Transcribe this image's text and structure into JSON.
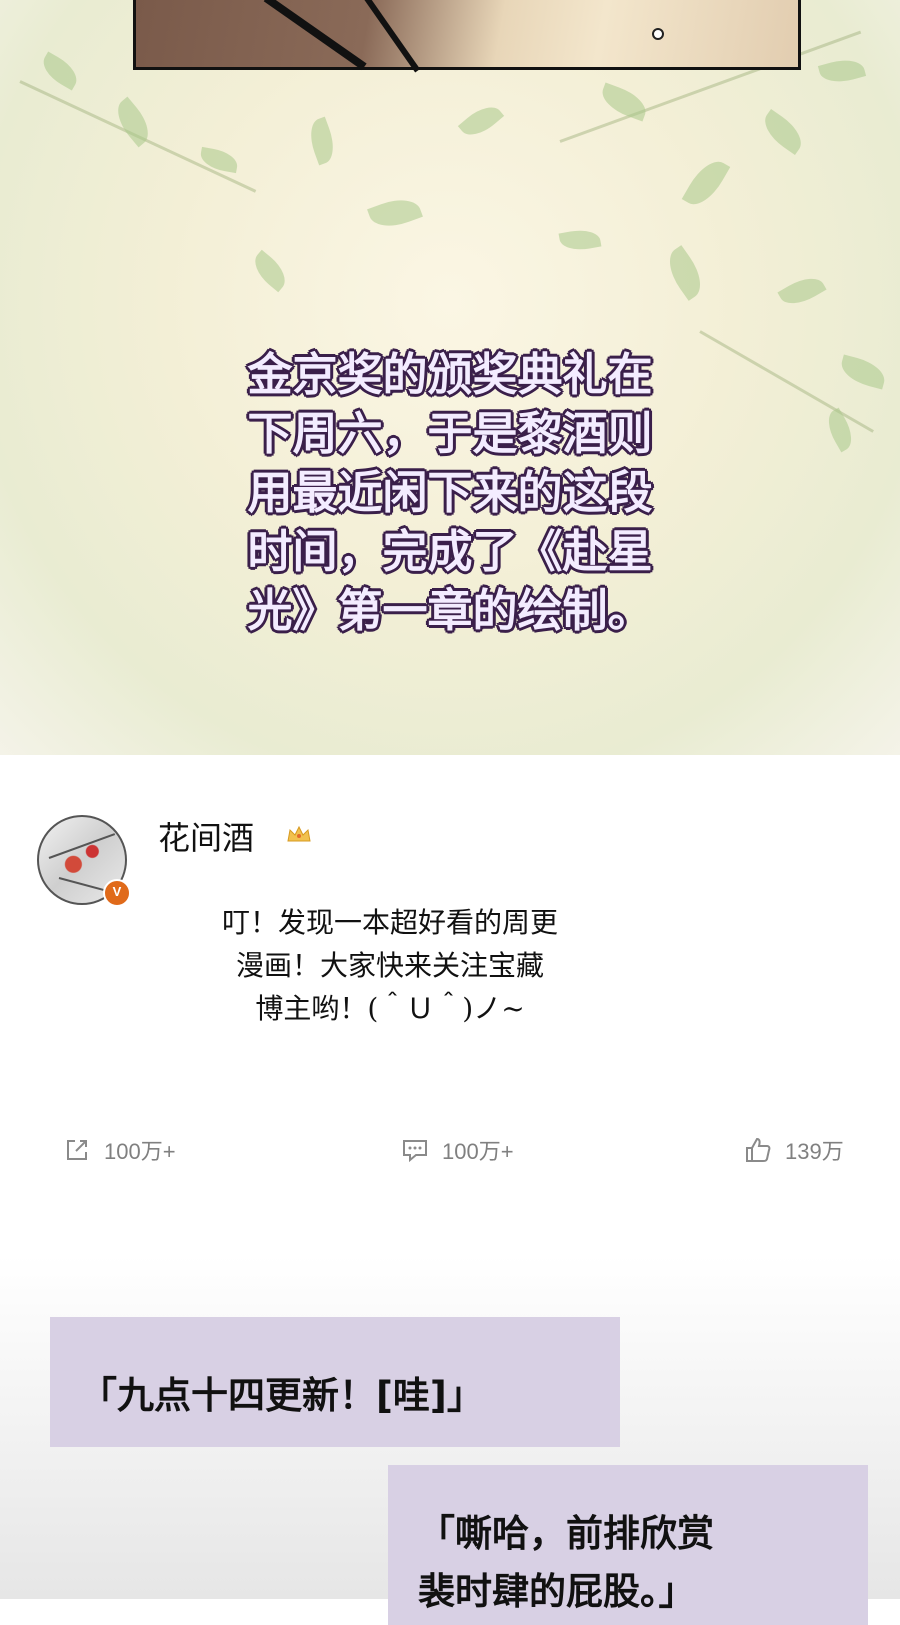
{
  "narration": {
    "lines": [
      "金京奖的颁奖典礼在",
      "下周六，于是黎酒则",
      "用最近闲下来的这段",
      "时间，完成了《赴星",
      "光》第一章的绘制。"
    ]
  },
  "post": {
    "username": "花间酒",
    "verified_badge": "V",
    "text_lines": [
      "叮！发现一本超好看的周更",
      "漫画！大家快来关注宝藏",
      "博主哟！(＾Ｕ＾)ノ~"
    ],
    "actions": {
      "share_count": "100万+",
      "comment_count": "100万+",
      "like_count": "139万"
    },
    "icons": {
      "share": "share-icon",
      "comment": "comment-icon",
      "like": "thumbs-up-icon",
      "crown": "crown-icon"
    }
  },
  "chat": {
    "bubble_1": "「九点十四更新！[哇]」",
    "bubble_2_lines": [
      "「嘶哈，前排欣赏",
      "裴时肆的屁股。」"
    ]
  },
  "colors": {
    "narration_fill": "#f3ecff",
    "narration_outline": "#3a1f4a",
    "bubble_bg": "#d8d0e4",
    "badge_orange": "#e06a1a",
    "action_gray": "#808080"
  }
}
